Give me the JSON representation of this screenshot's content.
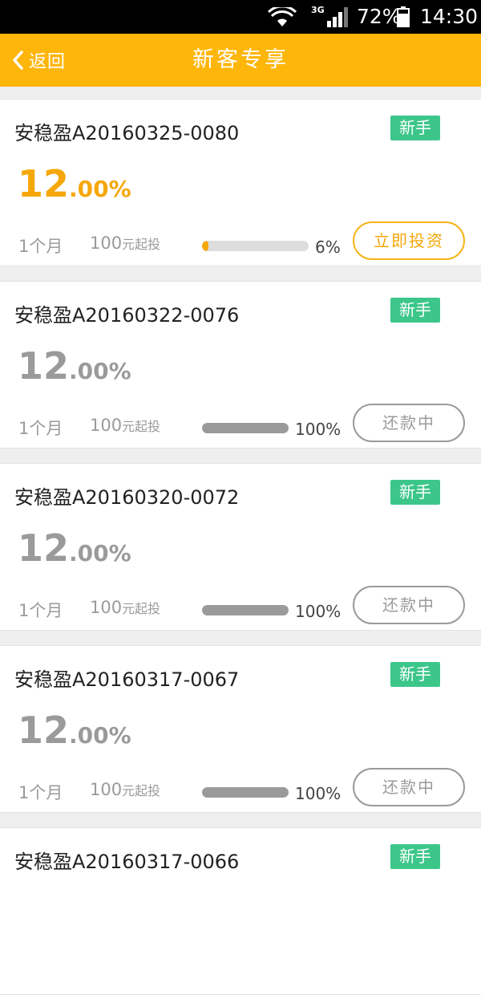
{
  "status_bar": {
    "network": "3G",
    "battery": "72%",
    "time": "14:30",
    "icons": [
      "wifi-icon",
      "signal-icon",
      "battery-icon"
    ]
  },
  "nav": {
    "back_label": "返回",
    "title": "新客专享"
  },
  "colors": {
    "accent": "#ffb60a",
    "rate_active": "#f5a70a",
    "badge_green": "#3cc68a",
    "muted": "#9a9a9a"
  },
  "products": [
    {
      "name": "安稳盈A20160325-0080",
      "badge": "新手",
      "rate_int": "12",
      "rate_dec": ".00%",
      "term": "1个月",
      "min_amount": "100",
      "min_unit": "元起投",
      "progress": "6%",
      "progress_value": 0.06,
      "action": "立即投资",
      "active": true
    },
    {
      "name": "安稳盈A20160322-0076",
      "badge": "新手",
      "rate_int": "12",
      "rate_dec": ".00%",
      "term": "1个月",
      "min_amount": "100",
      "min_unit": "元起投",
      "progress": "100%",
      "progress_value": 1.0,
      "action": "还款中",
      "active": false
    },
    {
      "name": "安稳盈A20160320-0072",
      "badge": "新手",
      "rate_int": "12",
      "rate_dec": ".00%",
      "term": "1个月",
      "min_amount": "100",
      "min_unit": "元起投",
      "progress": "100%",
      "progress_value": 1.0,
      "action": "还款中",
      "active": false
    },
    {
      "name": "安稳盈A20160317-0067",
      "badge": "新手",
      "rate_int": "12",
      "rate_dec": ".00%",
      "term": "1个月",
      "min_amount": "100",
      "min_unit": "元起投",
      "progress": "100%",
      "progress_value": 1.0,
      "action": "还款中",
      "active": false
    },
    {
      "name": "安稳盈A20160317-0066",
      "badge": "新手",
      "rate_int": "",
      "rate_dec": "",
      "term": "",
      "min_amount": "",
      "min_unit": "",
      "progress": "",
      "progress_value": 0,
      "action": "",
      "active": false
    }
  ]
}
